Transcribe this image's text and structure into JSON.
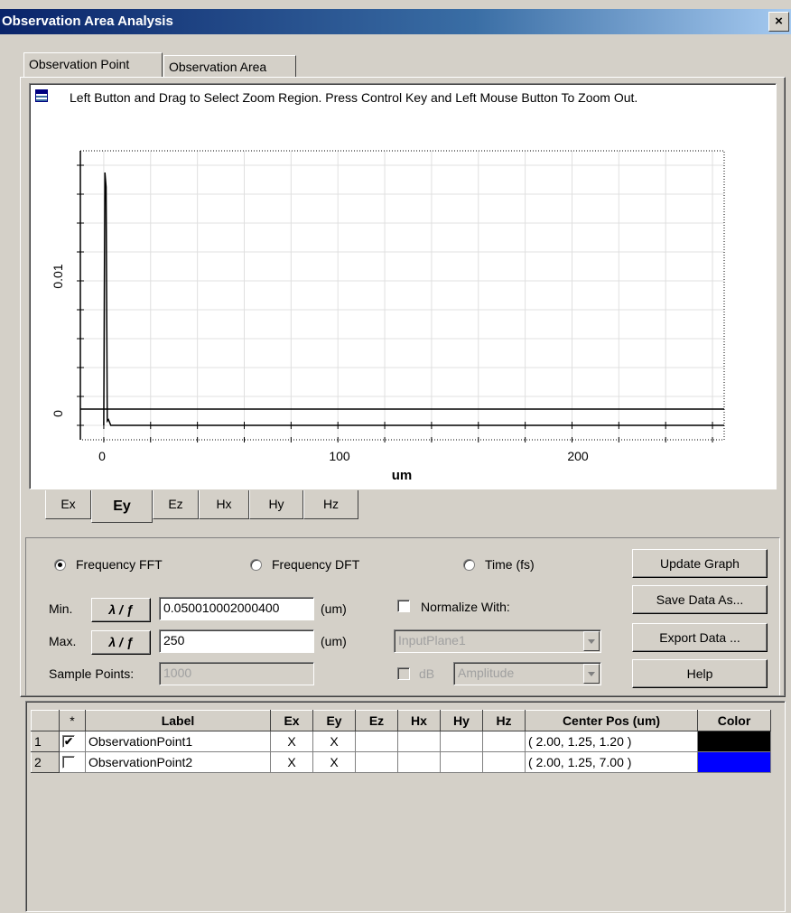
{
  "window": {
    "title": "Observation Area Analysis",
    "close": "×"
  },
  "tabs": [
    {
      "label": "Observation Point"
    },
    {
      "label": "Observation Area"
    }
  ],
  "plot": {
    "hint": "Left Button and Drag to Select Zoom Region. Press Control Key and Left Mouse Button To Zoom Out.",
    "xlabel": "um",
    "xticks": [
      "0",
      "100",
      "200"
    ],
    "yticks": [
      "0",
      "0.01"
    ]
  },
  "chart_data": {
    "type": "line",
    "title": "",
    "xlabel": "um",
    "ylabel": "",
    "xlim": [
      -10,
      265
    ],
    "ylim": [
      -0.001,
      0.019
    ],
    "grid": true,
    "series": [
      {
        "x": [
          0,
          0.5,
          1.0,
          1.5,
          2.0,
          3,
          265
        ],
        "y": [
          0,
          0.0175,
          0.0165,
          0.0003,
          0.0004,
          0,
          0
        ],
        "color": "#000000"
      }
    ]
  },
  "field_tabs": [
    "Ex",
    "Ey",
    "Ez",
    "Hx",
    "Hy",
    "Hz"
  ],
  "controls": {
    "mode": {
      "fft": "Frequency FFT",
      "dft": "Frequency DFT",
      "time": "Time (fs)",
      "selected": "fft"
    },
    "min_label": "Min.",
    "max_label": "Max.",
    "lambda_button": "λ / ƒ",
    "min_value": "0.050010002000400",
    "max_value": "250",
    "unit": "(um)",
    "sample_points_label": "Sample Points:",
    "sample_points_value": "1000",
    "normalize_label": "Normalize With:",
    "normalize_value": "InputPlane1",
    "db_label": "dB",
    "amplitude_value": "Amplitude"
  },
  "buttons": {
    "update": "Update Graph",
    "save": "Save Data As...",
    "export": "Export Data ...",
    "help": "Help"
  },
  "table": {
    "headers": [
      "",
      "*",
      "Label",
      "Ex",
      "Ey",
      "Ez",
      "Hx",
      "Hy",
      "Hz",
      "Center Pos (um)",
      "Color"
    ],
    "rows": [
      {
        "num": "1",
        "checked": true,
        "label": "ObservationPoint1",
        "ex": "X",
        "ey": "X",
        "ez": "",
        "hx": "",
        "hy": "",
        "hz": "",
        "center": "( 2.00, 1.25, 1.20 )",
        "color": "#000000"
      },
      {
        "num": "2",
        "checked": false,
        "label": "ObservationPoint2",
        "ex": "X",
        "ey": "X",
        "ez": "",
        "hx": "",
        "hy": "",
        "hz": "",
        "center": "( 2.00, 1.25, 7.00 )",
        "color": "#0000ff"
      }
    ]
  }
}
